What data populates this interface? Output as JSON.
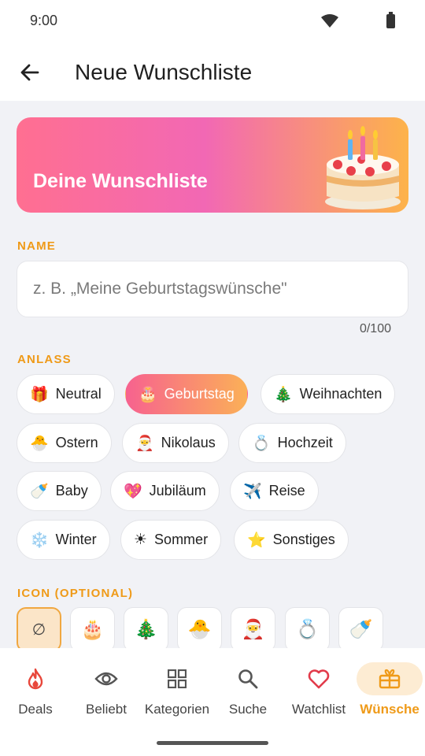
{
  "status": {
    "time": "9:00"
  },
  "header": {
    "title": "Neue Wunschliste"
  },
  "banner": {
    "title": "Deine Wunschliste"
  },
  "name_section": {
    "label": "NAME",
    "placeholder": "z. B. „Meine Geburtstagswünsche\"",
    "value": "",
    "counter": "0/100"
  },
  "occasion_section": {
    "label": "ANLASS",
    "chips": [
      {
        "emoji": "🎁",
        "label": "Neutral"
      },
      {
        "emoji": "🎂",
        "label": "Geburtstag",
        "selected": true
      },
      {
        "emoji": "🎄",
        "label": "Weihnachten"
      },
      {
        "emoji": "🐣",
        "label": "Ostern"
      },
      {
        "emoji": "🎅",
        "label": "Nikolaus"
      },
      {
        "emoji": "💍",
        "label": "Hochzeit"
      },
      {
        "emoji": "🍼",
        "label": "Baby"
      },
      {
        "emoji": "💖",
        "label": "Jubiläum"
      },
      {
        "emoji": "✈️",
        "label": "Reise"
      },
      {
        "emoji": "❄️",
        "label": "Winter"
      },
      {
        "emoji": "☀",
        "label": "Sommer"
      },
      {
        "emoji": "⭐",
        "label": "Sonstiges"
      }
    ]
  },
  "icon_section": {
    "label": "ICON (OPTIONAL)",
    "icons": [
      "∅",
      "🎂",
      "🎄",
      "🐣",
      "🎅",
      "💍",
      "🍼"
    ]
  },
  "bottom_nav": {
    "items": [
      {
        "label": "Deals",
        "icon": "flame-icon"
      },
      {
        "label": "Beliebt",
        "icon": "eye-icon"
      },
      {
        "label": "Kategorien",
        "icon": "grid-icon"
      },
      {
        "label": "Suche",
        "icon": "search-icon"
      },
      {
        "label": "Watchlist",
        "icon": "heart-icon"
      },
      {
        "label": "Wünsche",
        "icon": "gift-icon",
        "active": true
      }
    ]
  },
  "colors": {
    "accent": "#ef9a18",
    "banner_gradient": [
      "#ff6f91",
      "#f268b4",
      "#fdb34a"
    ],
    "deals_icon": "#e8473b",
    "watchlist_icon": "#e23b4a"
  }
}
